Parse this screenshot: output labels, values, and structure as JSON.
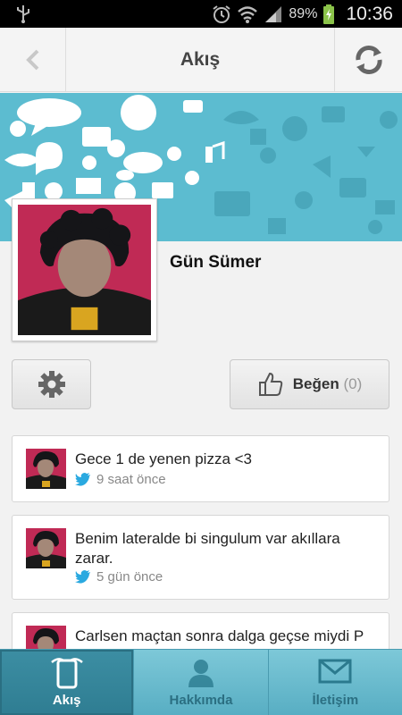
{
  "status_bar": {
    "battery_percent": "89%",
    "time": "10:36"
  },
  "action_bar": {
    "title": "Akış"
  },
  "profile": {
    "name": "Gün Sümer"
  },
  "like_button": {
    "label": "Beğen",
    "count": "(0)"
  },
  "feed": [
    {
      "text": "Gece 1 de yenen pizza <3",
      "time": "9 saat önce",
      "source_icon": "twitter-icon"
    },
    {
      "text": "Benim lateralde bi singulum var akıllara zarar.",
      "time": "5 gün önce",
      "source_icon": "twitter-icon"
    },
    {
      "text": "Carlsen maçtan sonra dalga geçse miydi P",
      "time": "",
      "source_icon": "twitter-icon"
    }
  ],
  "tabs": [
    {
      "label": "Akış",
      "active": true,
      "icon": "phone-icon"
    },
    {
      "label": "Hakkımda",
      "active": false,
      "icon": "person-icon"
    },
    {
      "label": "İletişim",
      "active": false,
      "icon": "envelope-icon"
    }
  ],
  "colors": {
    "banner": "#5cbcd0",
    "tab_bar": "#6dbdd0",
    "tab_active": "#3586a0",
    "twitter": "#2aa9e0"
  }
}
